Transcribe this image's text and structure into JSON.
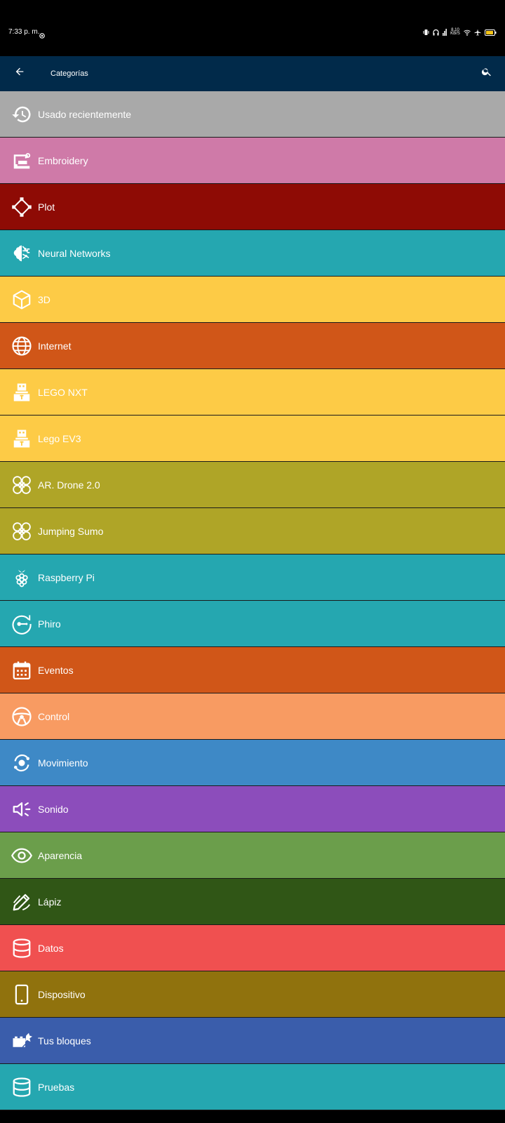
{
  "status_bar": {
    "time": "7:33 p. m.",
    "network_speed": "8.10 KB/S"
  },
  "app_bar": {
    "title": "Categorías",
    "back_icon": "arrow-left-icon",
    "search_icon": "search-icon"
  },
  "categories": [
    {
      "label": "Usado recientemente",
      "icon": "history-icon",
      "color": "#a9a9a9"
    },
    {
      "label": "Embroidery",
      "icon": "sewing-machine-icon",
      "color": "#cf7aa8"
    },
    {
      "label": "Plot",
      "icon": "vector-nodes-icon",
      "color": "#8e0b05"
    },
    {
      "label": "Neural Networks",
      "icon": "brain-icon",
      "color": "#25a7b0"
    },
    {
      "label": "3D",
      "icon": "cube-icon",
      "color": "#fdcb46"
    },
    {
      "label": "Internet",
      "icon": "globe-icon",
      "color": "#d05618"
    },
    {
      "label": "LEGO NXT",
      "icon": "robot-brick-icon",
      "color": "#fdcb46"
    },
    {
      "label": "Lego EV3",
      "icon": "robot-brick-icon",
      "color": "#fdcb46"
    },
    {
      "label": "AR. Drone 2.0",
      "icon": "drone-icon",
      "color": "#afa527"
    },
    {
      "label": "Jumping Sumo",
      "icon": "drone-icon",
      "color": "#afa527"
    },
    {
      "label": "Raspberry Pi",
      "icon": "raspberry-icon",
      "color": "#25a7b0"
    },
    {
      "label": "Phiro",
      "icon": "phiro-icon",
      "color": "#25a7b0"
    },
    {
      "label": "Eventos",
      "icon": "calendar-icon",
      "color": "#d05618"
    },
    {
      "label": "Control",
      "icon": "steering-wheel-icon",
      "color": "#f89b62"
    },
    {
      "label": "Movimiento",
      "icon": "motion-icon",
      "color": "#3e89c6"
    },
    {
      "label": "Sonido",
      "icon": "speaker-icon",
      "color": "#8c4dbb"
    },
    {
      "label": "Aparencia",
      "icon": "eye-icon",
      "color": "#6b9e4b"
    },
    {
      "label": "Lápiz",
      "icon": "pen-icon",
      "color": "#305616"
    },
    {
      "label": "Datos",
      "icon": "database-icon",
      "color": "#f05050"
    },
    {
      "label": "Dispositivo",
      "icon": "phone-device-icon",
      "color": "#90720d"
    },
    {
      "label": "Tus bloques",
      "icon": "bricks-icon",
      "color": "#3a5dab"
    },
    {
      "label": "Pruebas",
      "icon": "database-icon",
      "color": "#25a7b0"
    }
  ]
}
